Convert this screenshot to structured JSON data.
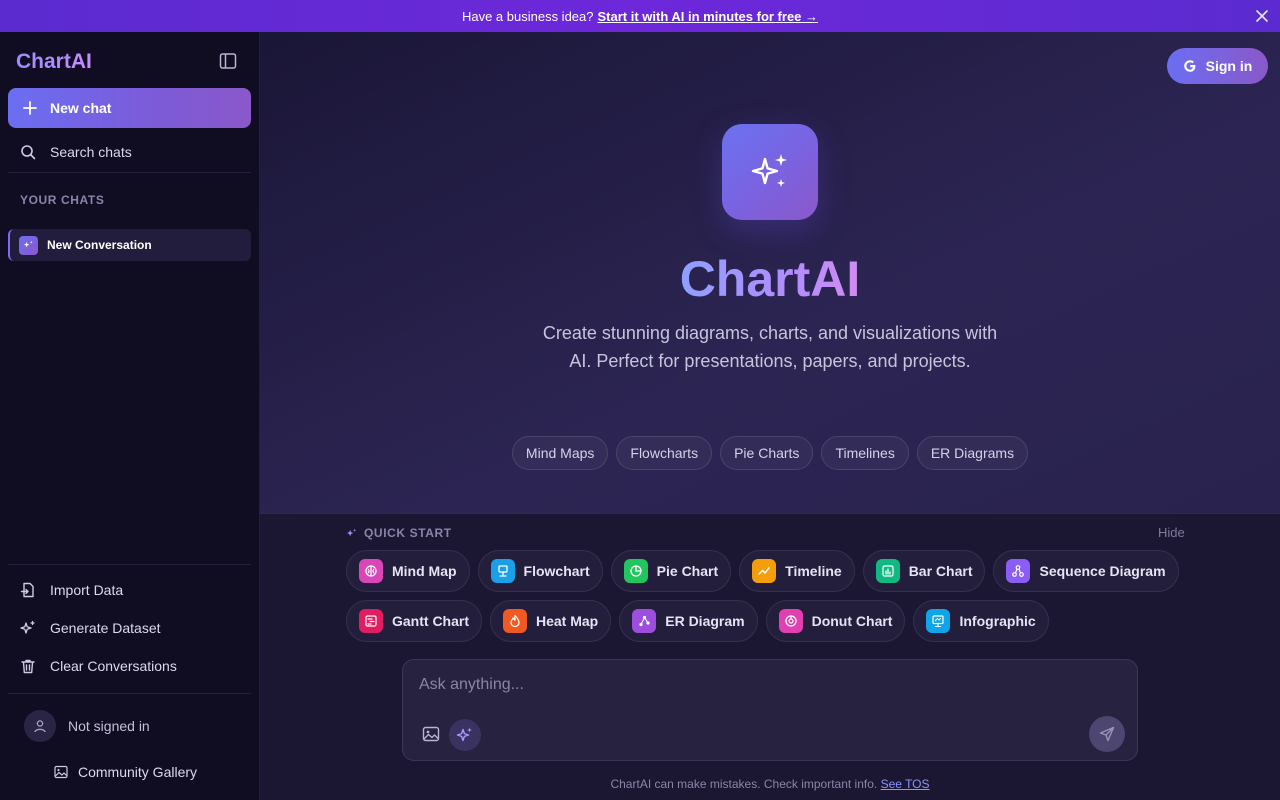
{
  "banner": {
    "lead": "Have a business idea?",
    "link": "Start it with AI in minutes for free →",
    "close_icon": "close-icon"
  },
  "sidebar": {
    "brand": "ChartAI",
    "new_chat": "New chat",
    "search": "Search chats",
    "section_label": "YOUR CHATS",
    "chats": [
      {
        "label": "New Conversation"
      }
    ],
    "actions": {
      "import": "Import Data",
      "generate": "Generate Dataset",
      "clear": "Clear Conversations"
    },
    "user_status": "Not signed in",
    "gallery": "Community Gallery"
  },
  "header": {
    "signin": "Sign in"
  },
  "hero": {
    "title": "ChartAI",
    "subtitle": "Create stunning diagrams, charts, and visualizations with AI. Perfect for presentations, papers, and projects.",
    "tags": [
      "Mind Maps",
      "Flowcharts",
      "Pie Charts",
      "Timelines",
      "ER Diagrams"
    ]
  },
  "quick_start": {
    "label": "QUICK START",
    "hide": "Hide",
    "row1": [
      {
        "label": "Mind Map",
        "color": "#d946b8"
      },
      {
        "label": "Flowchart",
        "color": "#1aa0e8"
      },
      {
        "label": "Pie Chart",
        "color": "#22c55e"
      },
      {
        "label": "Timeline",
        "color": "#f59e0b"
      },
      {
        "label": "Bar Chart",
        "color": "#10b981"
      },
      {
        "label": "Sequence Diagram",
        "color": "#8b5cf6"
      }
    ],
    "row2": [
      {
        "label": "Gantt Chart",
        "color": "#e11d62"
      },
      {
        "label": "Heat Map",
        "color": "#f05a22"
      },
      {
        "label": "ER Diagram",
        "color": "#9d4edd"
      },
      {
        "label": "Donut Chart",
        "color": "#e040b0"
      },
      {
        "label": "Infographic",
        "color": "#0ea5e9"
      }
    ]
  },
  "composer": {
    "placeholder": "Ask anything..."
  },
  "footer": {
    "disclaimer": "ChartAI can make mistakes. Check important info.",
    "tos": "See TOS"
  }
}
